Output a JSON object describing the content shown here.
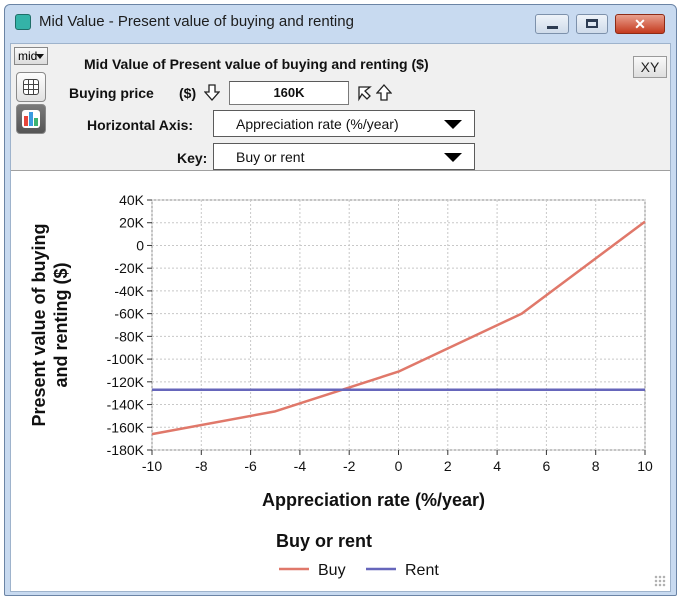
{
  "window": {
    "title": "Mid Value - Present value of buying and renting",
    "min_glyph": "",
    "max_glyph": "",
    "close_glyph": "✕"
  },
  "toolbar": {
    "mid_label": "mid",
    "xy_label": "XY"
  },
  "panel": {
    "heading": "Mid Value of Present value of buying and renting ($)",
    "input_label": "Buying price",
    "input_unit": "($)",
    "input_value": "160K",
    "axis_label": "Horizontal Axis:",
    "axis_value": "Appreciation rate (%/year)",
    "key_label": "Key:",
    "key_value": "Buy or rent"
  },
  "chart_data": {
    "type": "line",
    "xlabel": "Appreciation rate (%/year)",
    "ylabel": "Present value of buying and renting ($)",
    "ylabel_lines": [
      "Present value of buying",
      "and renting ($)"
    ],
    "xlim": [
      -10,
      10
    ],
    "ylim": [
      -180000,
      40000
    ],
    "x_ticks": [
      -10,
      -8,
      -6,
      -4,
      -2,
      0,
      2,
      4,
      6,
      8,
      10
    ],
    "x_tick_labels": [
      "-10",
      "-8",
      "-6",
      "-4",
      "-2",
      "0",
      "2",
      "4",
      "6",
      "8",
      "10"
    ],
    "y_ticks": [
      40000,
      20000,
      0,
      -20000,
      -40000,
      -60000,
      -80000,
      -100000,
      -120000,
      -140000,
      -160000,
      -180000
    ],
    "y_tick_labels": [
      "40K",
      "20K",
      "0",
      "-20K",
      "-40K",
      "-60K",
      "-80K",
      "-100K",
      "-120K",
      "-140K",
      "-160K",
      "-180K"
    ],
    "grid": true,
    "legend_title": "Buy or rent",
    "legend_position": "bottom-left",
    "series": [
      {
        "name": "Buy",
        "color": "#e0786a",
        "x": [
          -10,
          -5,
          0,
          5,
          10
        ],
        "y": [
          -166000,
          -146000,
          -111000,
          -60000,
          21000
        ]
      },
      {
        "name": "Rent",
        "color": "#6666bb",
        "x": [
          -10,
          10
        ],
        "y": [
          -127000,
          -127000
        ]
      }
    ]
  }
}
